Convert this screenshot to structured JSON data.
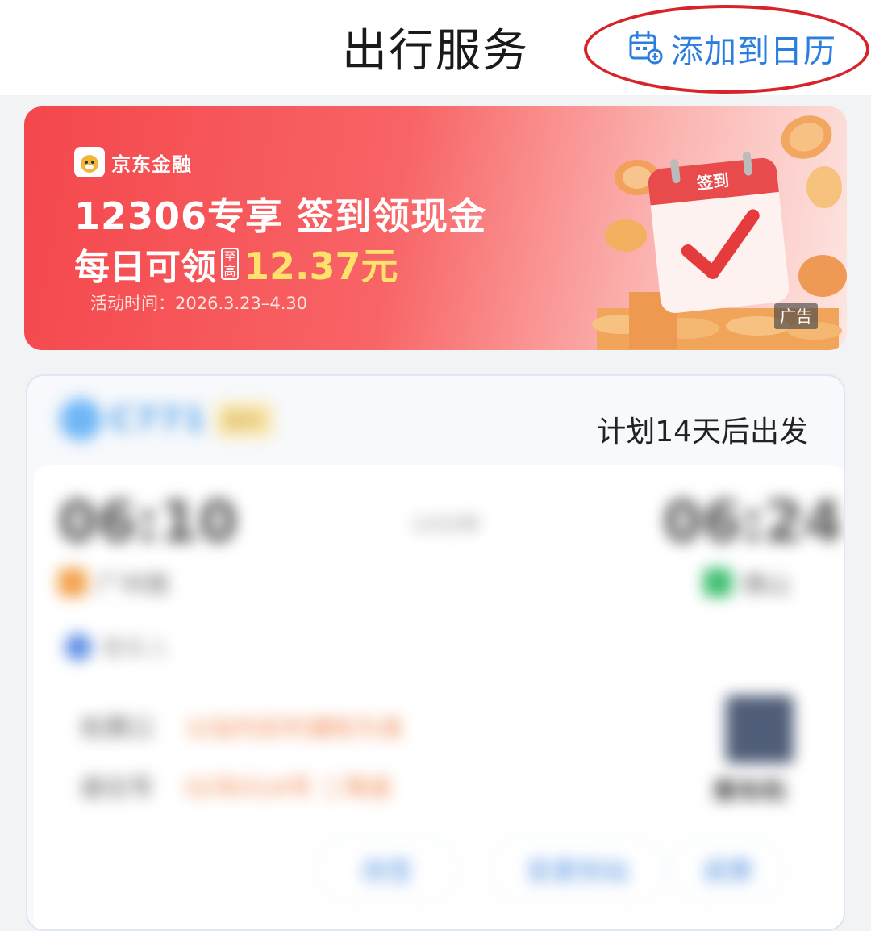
{
  "header": {
    "title": "出行服务",
    "add_calendar_label": "添加到日历",
    "add_calendar_icon": "calendar-add-icon",
    "accent_color": "#2b7ee0",
    "highlight_color": "#d8232a"
  },
  "banner": {
    "brand": "京东金融",
    "title": "12306专享 签到领现金",
    "daily_label": "每日可领",
    "up_to_label": "至高",
    "amount": "12.37元",
    "period": "活动时间：2026.3.23–4.30",
    "calendar_text": "签到",
    "ad_label": "广告"
  },
  "trip": {
    "plan_text": "计划14天后出发",
    "train_no": "C771",
    "train_tag": "候补",
    "depart_time": "06:10",
    "arrive_time": "06:24",
    "duration": "14分钟",
    "depart_station": "广州南",
    "arrive_station": "佛山",
    "passenger": "乘车人",
    "check_label": "检票口",
    "check_value": "以站内实时通知为准",
    "seat_label": "座位号",
    "seat_value": "02车01A号 二等座",
    "qr_label": "乘车码",
    "buttons": [
      "改签",
      "变更到站",
      "退票"
    ]
  }
}
